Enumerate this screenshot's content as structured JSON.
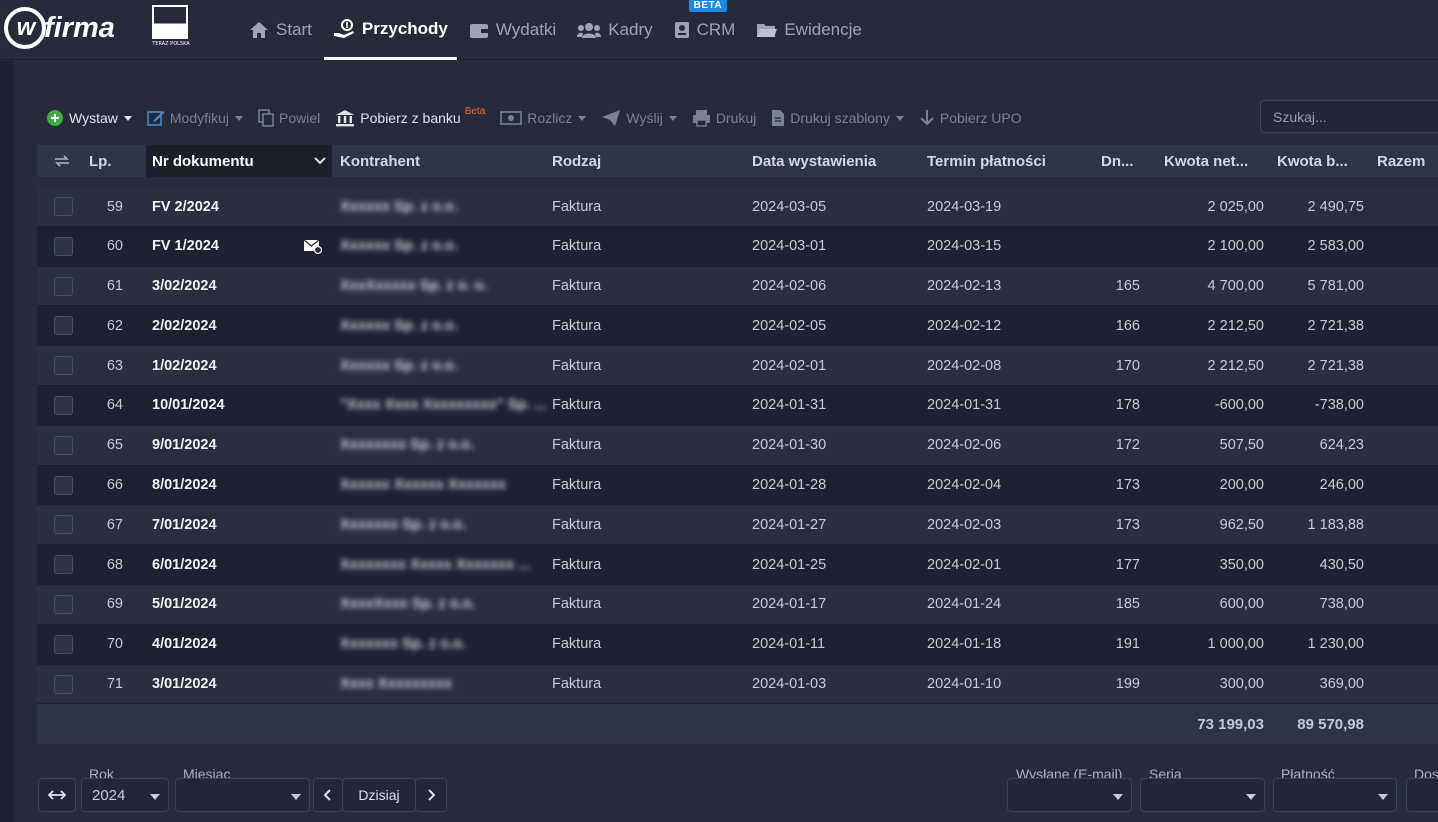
{
  "brand": {
    "logo_letter": "w",
    "logo_text": "firma",
    "badge_caption": "TERAZ POLSKA"
  },
  "nav": [
    {
      "label": "Start",
      "icon": "home-icon"
    },
    {
      "label": "Przychody",
      "icon": "income-icon",
      "active": true
    },
    {
      "label": "Wydatki",
      "icon": "wallet-icon"
    },
    {
      "label": "Kadry",
      "icon": "people-icon"
    },
    {
      "label": "CRM",
      "icon": "crm-icon",
      "badge": "BETA"
    },
    {
      "label": "Ewidencje",
      "icon": "folder-icon"
    }
  ],
  "toolbar": {
    "wystaw": "Wystaw",
    "modyfikuj": "Modyfikuj",
    "powiel": "Powiel",
    "pobierz_z_banku": "Pobierz z banku",
    "pobierz_beta": "Beta",
    "rozlicz": "Rozlicz",
    "wyslij": "Wyślij",
    "drukuj": "Drukuj",
    "drukuj_szablony": "Drukuj szablony",
    "pobierz_upo": "Pobierz UPO",
    "search_placeholder": "Szukaj..."
  },
  "columns": {
    "lp": "Lp.",
    "nr": "Nr dokumentu",
    "kontrahent": "Kontrahent",
    "rodzaj": "Rodzaj",
    "data": "Data wystawienia",
    "termin": "Termin płatności",
    "dni": "Dn...",
    "netto": "Kwota net...",
    "brutto": "Kwota b...",
    "razem": "Razem"
  },
  "rows": [
    {
      "lp": "59",
      "nr": "FV 2/2024",
      "kontrahent": "Xxxxxx Sp. z o.o.",
      "rodzaj": "Faktura",
      "data": "2024-03-05",
      "termin": "2024-03-19",
      "dni": "",
      "netto": "2 025,00",
      "brutto": "2 490,75",
      "mail": false
    },
    {
      "lp": "60",
      "nr": "FV 1/2024",
      "kontrahent": "Xxxxxx Sp. z o.o.",
      "rodzaj": "Faktura",
      "data": "2024-03-01",
      "termin": "2024-03-15",
      "dni": "",
      "netto": "2 100,00",
      "brutto": "2 583,00",
      "mail": true
    },
    {
      "lp": "61",
      "nr": "3/02/2024",
      "kontrahent": "XxxXxxxxx Sp. z o. o.",
      "rodzaj": "Faktura",
      "data": "2024-02-06",
      "termin": "2024-02-13",
      "dni": "165",
      "netto": "4 700,00",
      "brutto": "5 781,00",
      "mail": false
    },
    {
      "lp": "62",
      "nr": "2/02/2024",
      "kontrahent": "Xxxxxx Sp. z o.o.",
      "rodzaj": "Faktura",
      "data": "2024-02-05",
      "termin": "2024-02-12",
      "dni": "166",
      "netto": "2 212,50",
      "brutto": "2 721,38",
      "mail": false
    },
    {
      "lp": "63",
      "nr": "1/02/2024",
      "kontrahent": "Xxxxxx Sp. z o.o.",
      "rodzaj": "Faktura",
      "data": "2024-02-01",
      "termin": "2024-02-08",
      "dni": "170",
      "netto": "2 212,50",
      "brutto": "2 721,38",
      "mail": false
    },
    {
      "lp": "64",
      "nr": "10/01/2024",
      "kontrahent": "\"Xxxx Xxxx Xxxxxxxxx\" Sp. ...",
      "rodzaj": "Faktura",
      "data": "2024-01-31",
      "termin": "2024-01-31",
      "dni": "178",
      "netto": "-600,00",
      "brutto": "-738,00",
      "mail": false
    },
    {
      "lp": "65",
      "nr": "9/01/2024",
      "kontrahent": "Xxxxxxxx Sp. z o.o.",
      "rodzaj": "Faktura",
      "data": "2024-01-30",
      "termin": "2024-02-06",
      "dni": "172",
      "netto": "507,50",
      "brutto": "624,23",
      "mail": false
    },
    {
      "lp": "66",
      "nr": "8/01/2024",
      "kontrahent": "Xxxxxx Xxxxxx Xxxxxxx",
      "rodzaj": "Faktura",
      "data": "2024-01-28",
      "termin": "2024-02-04",
      "dni": "173",
      "netto": "200,00",
      "brutto": "246,00",
      "mail": false
    },
    {
      "lp": "67",
      "nr": "7/01/2024",
      "kontrahent": "Xxxxxxx Sp. z o.o.",
      "rodzaj": "Faktura",
      "data": "2024-01-27",
      "termin": "2024-02-03",
      "dni": "173",
      "netto": "962,50",
      "brutto": "1 183,88",
      "mail": false
    },
    {
      "lp": "68",
      "nr": "6/01/2024",
      "kontrahent": "Xxxxxxxx Xxxxx Xxxxxxx ...",
      "rodzaj": "Faktura",
      "data": "2024-01-25",
      "termin": "2024-02-01",
      "dni": "177",
      "netto": "350,00",
      "brutto": "430,50",
      "mail": false
    },
    {
      "lp": "69",
      "nr": "5/01/2024",
      "kontrahent": "XxxxXxxx Sp. z o.o.",
      "rodzaj": "Faktura",
      "data": "2024-01-17",
      "termin": "2024-01-24",
      "dni": "185",
      "netto": "600,00",
      "brutto": "738,00",
      "mail": false
    },
    {
      "lp": "70",
      "nr": "4/01/2024",
      "kontrahent": "Xxxxxxx Sp. z o.o.",
      "rodzaj": "Faktura",
      "data": "2024-01-11",
      "termin": "2024-01-18",
      "dni": "191",
      "netto": "1 000,00",
      "brutto": "1 230,00",
      "mail": false
    },
    {
      "lp": "71",
      "nr": "3/01/2024",
      "kontrahent": "Xxxx Xxxxxxxxx",
      "rodzaj": "Faktura",
      "data": "2024-01-03",
      "termin": "2024-01-10",
      "dni": "199",
      "netto": "300,00",
      "brutto": "369,00",
      "mail": false
    }
  ],
  "totals": {
    "netto": "73 199,03",
    "brutto": "89 570,98"
  },
  "filters": {
    "rok_label": "Rok",
    "rok_value": "2024",
    "miesiac_label": "Miesiąc",
    "miesiac_value": "",
    "today": "Dzisiaj",
    "wyslane_label": "Wysłane (E-mail)",
    "seria_label": "Seria",
    "platnosc_label": "Płatność",
    "dos_label": "Dos"
  }
}
